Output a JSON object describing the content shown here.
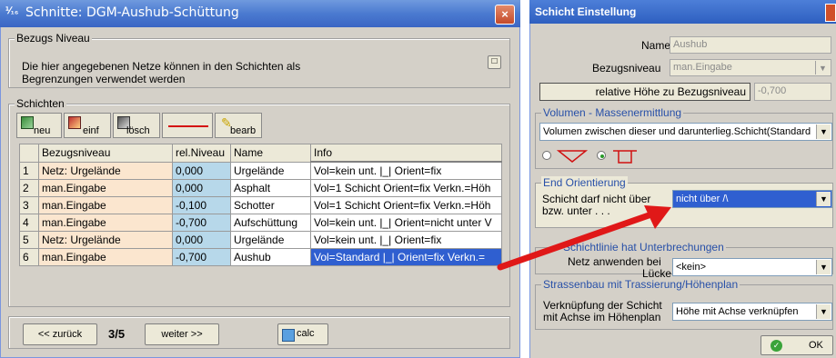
{
  "left_window": {
    "title": "Schnitte: DGM-Aushub-Schüttung",
    "icon_text": "⅟₁₆",
    "close_label": "×",
    "bezugs_group": {
      "title": "Bezugs Niveau",
      "text_line1": "Die hier angegebenen Netze können  in den Schichten als",
      "text_line2": "Begrenzungen verwendet werden"
    },
    "schichten_group": {
      "title": "Schichten"
    },
    "toolbar": {
      "neu": "neu",
      "einf": "einf",
      "losch": "lösch",
      "bearb": "bearb"
    },
    "table": {
      "headers": [
        "Bezugsniveau",
        "rel.Niveau",
        "Name",
        "Info"
      ],
      "rows": [
        {
          "n": "1",
          "bezug": "Netz: Urgelände",
          "rel": "0,000",
          "name": "Urgelände",
          "info": "Vol=kein unt. |_| Orient=fix"
        },
        {
          "n": "2",
          "bezug": "man.Eingabe",
          "rel": "0,000",
          "name": "Asphalt",
          "info": "Vol=1 Schicht Orient=fix Verkn.=Höh"
        },
        {
          "n": "3",
          "bezug": "man.Eingabe",
          "rel": "-0,100",
          "name": "Schotter",
          "info": "Vol=1 Schicht Orient=fix Verkn.=Höh"
        },
        {
          "n": "4",
          "bezug": "man.Eingabe",
          "rel": "-0,700",
          "name": "Aufschüttung",
          "info": "Vol=kein unt. |_| Orient=nicht unter V"
        },
        {
          "n": "5",
          "bezug": "Netz: Urgelände",
          "rel": "0,000",
          "name": "Urgelände",
          "info": "Vol=kein unt. |_| Orient=fix"
        },
        {
          "n": "6",
          "bezug": "man.Eingabe",
          "rel": "-0,700",
          "name": "Aushub",
          "info": "Vol=Standard  |_| Orient=fix Verkn.="
        }
      ]
    },
    "footer": {
      "back": "<< zurück",
      "page": "3/5",
      "next": "weiter >>",
      "calc": "calc"
    }
  },
  "right_window": {
    "title": "Schicht Einstellung",
    "name_label": "Name",
    "name_value": "Aushub",
    "bezug_label": "Bezugsniveau",
    "bezug_value": "man.Eingabe",
    "rel_button": "relative Höhe zu Bezugsniveau",
    "rel_value": "-0,700",
    "volumen_group": "Volumen - Massenermittlung",
    "volumen_value": "Volumen zwischen dieser und darunterlieg.Schicht(Standard",
    "end_group": "End Orientierung",
    "end_label_1": "Schicht darf nicht über",
    "end_label_2": "bzw. unter . . .",
    "end_value": "nicht über /\\",
    "schicht_group": "Schichtlinie hat Unterbrechungen",
    "netz_label_1": "Netz anwenden bei",
    "netz_label_2": "Lücke",
    "netz_value": "<kein>",
    "strassen_group": "Strassenbau mit Trassierung/Höhenplan",
    "verkn_label_1": "Verknüpfung der Schicht",
    "verkn_label_2": "mit Achse im Höhenplan",
    "verkn_value": "Höhe mit Achse verknüpfen",
    "ok": "OK"
  }
}
